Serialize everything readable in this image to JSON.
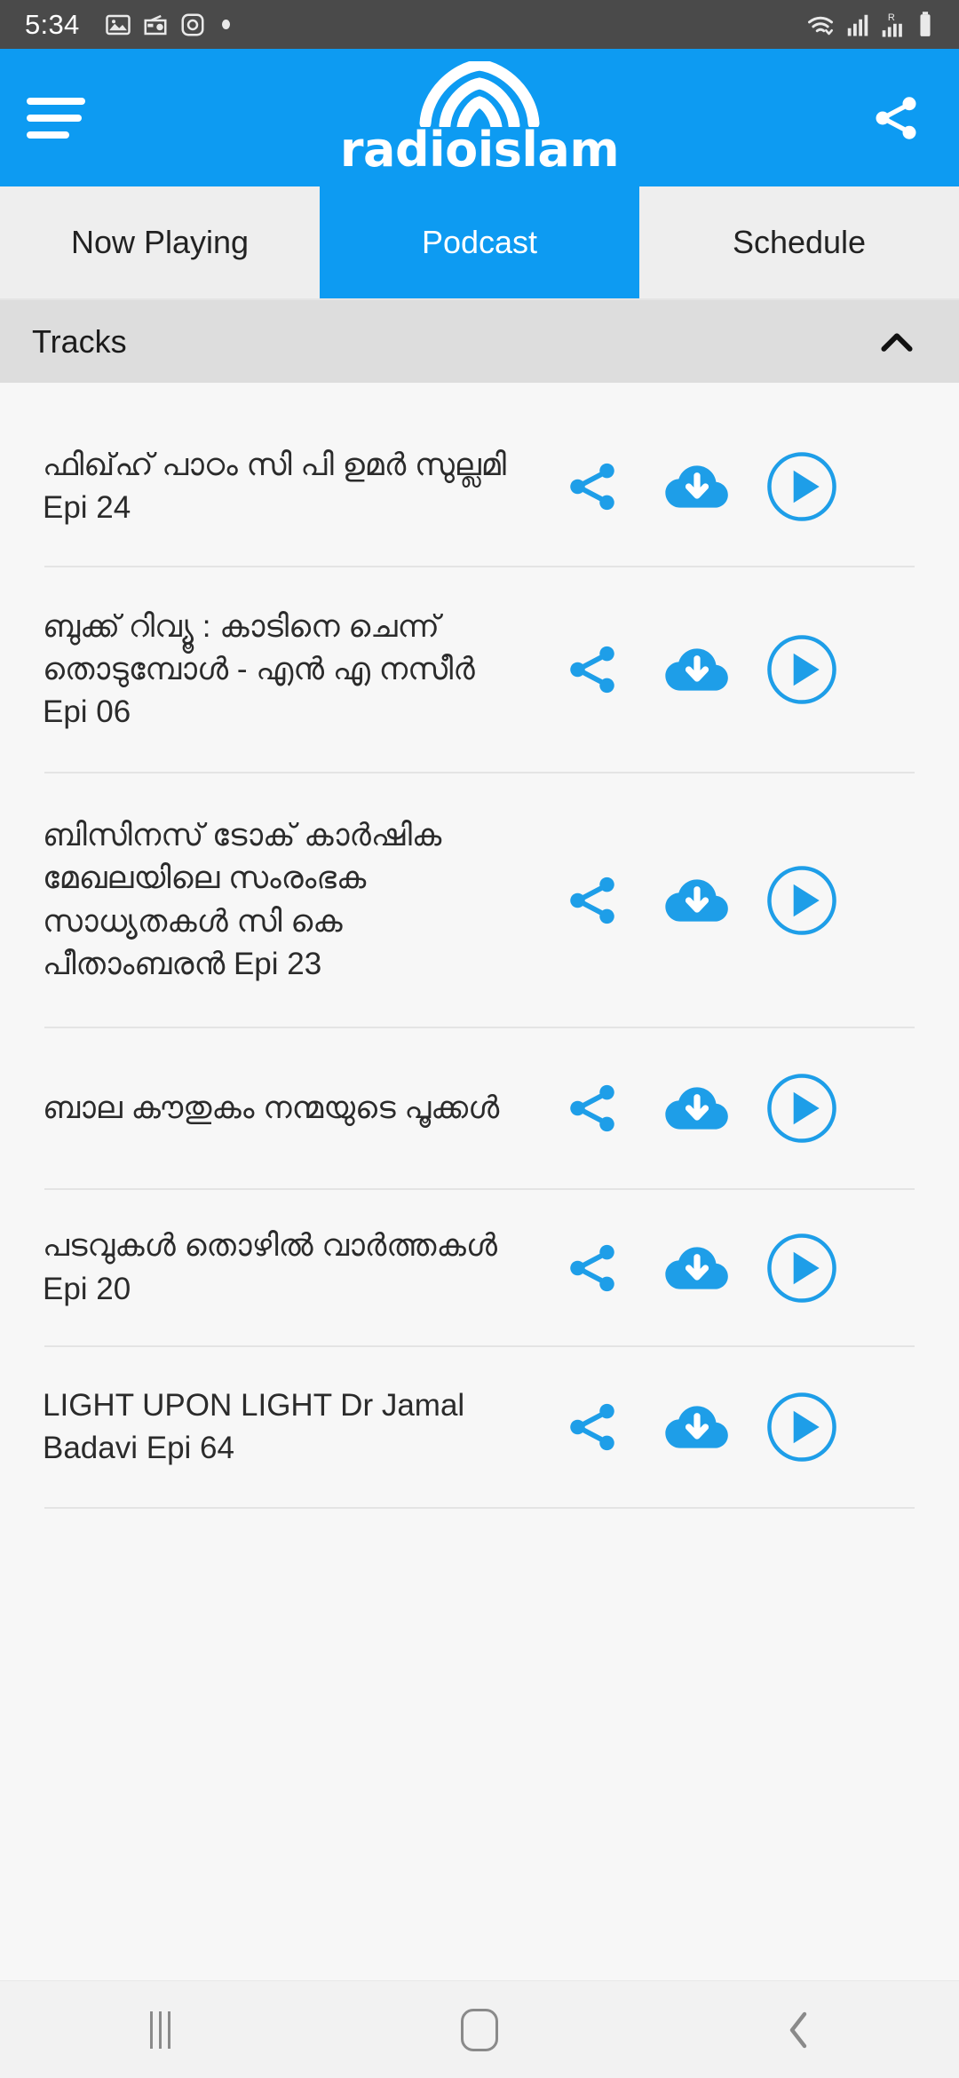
{
  "statusbar": {
    "time": "5:34",
    "left_icons": [
      "image-icon",
      "radio-icon",
      "instagram-icon",
      "dot-indicator"
    ],
    "right_icons": [
      "wifi-icon",
      "signal-icon",
      "roaming-signal-icon",
      "battery-icon"
    ],
    "roaming_label": "R"
  },
  "appbar": {
    "menu_icon": "hamburger-icon",
    "logo_icon": "radioislam-dome-logo",
    "brand": "radioislam",
    "share_icon": "share-icon"
  },
  "tabs": [
    {
      "label": "Now Playing",
      "active": false
    },
    {
      "label": "Podcast",
      "active": true
    },
    {
      "label": "Schedule",
      "active": false
    }
  ],
  "section": {
    "title": "Tracks",
    "chevron_icon": "chevron-up-icon"
  },
  "actions": {
    "share_icon": "share-icon",
    "download_icon": "cloud-download-icon",
    "play_icon": "play-circle-icon"
  },
  "tracks": [
    {
      "title": "ഫിഖ്‌ഹ് പാഠം സി പി ഉമർ സുല്ലമി Epi 24"
    },
    {
      "title": "ബുക്ക് റിവ്യൂ : കാടിനെ ചെന്ന് തൊടുമ്പോൾ - എൻ എ നസീർ Epi 06"
    },
    {
      "title": "ബിസിനസ് ടോക് കാർഷിക മേഖലയിലെ സംരംഭക സാധ്യതകൾ സി കെ പീതാംബരൻ  Epi 23"
    },
    {
      "title": "ബാല കൗതുകം   നന്മയുടെ പൂക്കൾ"
    },
    {
      "title": "പടവുകൾ  തൊഴിൽ വാർത്തകൾ  Epi 20"
    },
    {
      "title": "LIGHT UPON LIGHT  Dr Jamal Badavi Epi 64"
    }
  ],
  "navbar": {
    "recents_icon": "recents-icon",
    "home_icon": "home-icon",
    "back_icon": "back-icon"
  },
  "colors": {
    "accent": "#0d9bf2",
    "icon_blue": "#1e9ee8",
    "statusbar_bg": "#4a4a4a",
    "tabbar_bg": "#eeeeee",
    "section_bg": "#dddddd",
    "list_bg": "#f7f7f7",
    "navbar_bg": "#f2f2f2"
  }
}
